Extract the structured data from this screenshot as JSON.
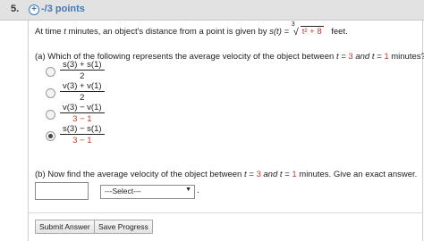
{
  "header": {
    "question_number": "5.",
    "expand_symbol": "+",
    "points_label": "-/3 points"
  },
  "question": {
    "intro_prefix": "At time",
    "intro_t": "t",
    "intro_middle": "minutes, an object's distance from a point is given by",
    "function_lhs": "s(t) =",
    "root_index": "3",
    "radical_sign": "√",
    "radicand": "t² + 8",
    "unit": "feet."
  },
  "part_a": {
    "label": "(a)",
    "text_prefix": "Which of the following represents the average velocity of the object between",
    "t_eq": "t =",
    "t1": "3",
    "and_t_eq": "and t =",
    "t2": "1",
    "text_suffix": "minutes?",
    "options": [
      {
        "numerator": "s(3) + s(1)",
        "denominator": "2",
        "checked": false
      },
      {
        "numerator": "v(3) + v(1)",
        "denominator": "2",
        "checked": false
      },
      {
        "numerator": "v(3) − v(1)",
        "denominator": "3 − 1",
        "checked": false
      },
      {
        "numerator": "s(3) − s(1)",
        "denominator": "3 − 1",
        "checked": true
      }
    ]
  },
  "part_b": {
    "label": "(b)",
    "text_prefix": "Now find the average velocity of the object between",
    "t_eq": "t =",
    "t1": "3",
    "and_t_eq": "and t =",
    "t2": "1",
    "text_suffix": "minutes. Give an exact answer.",
    "answer_value": "",
    "select_value": "---Select---",
    "select_arrow": "▼",
    "trailing_dot": "."
  },
  "buttons": {
    "submit_label": "Submit Answer",
    "save_label": "Save Progress"
  }
}
